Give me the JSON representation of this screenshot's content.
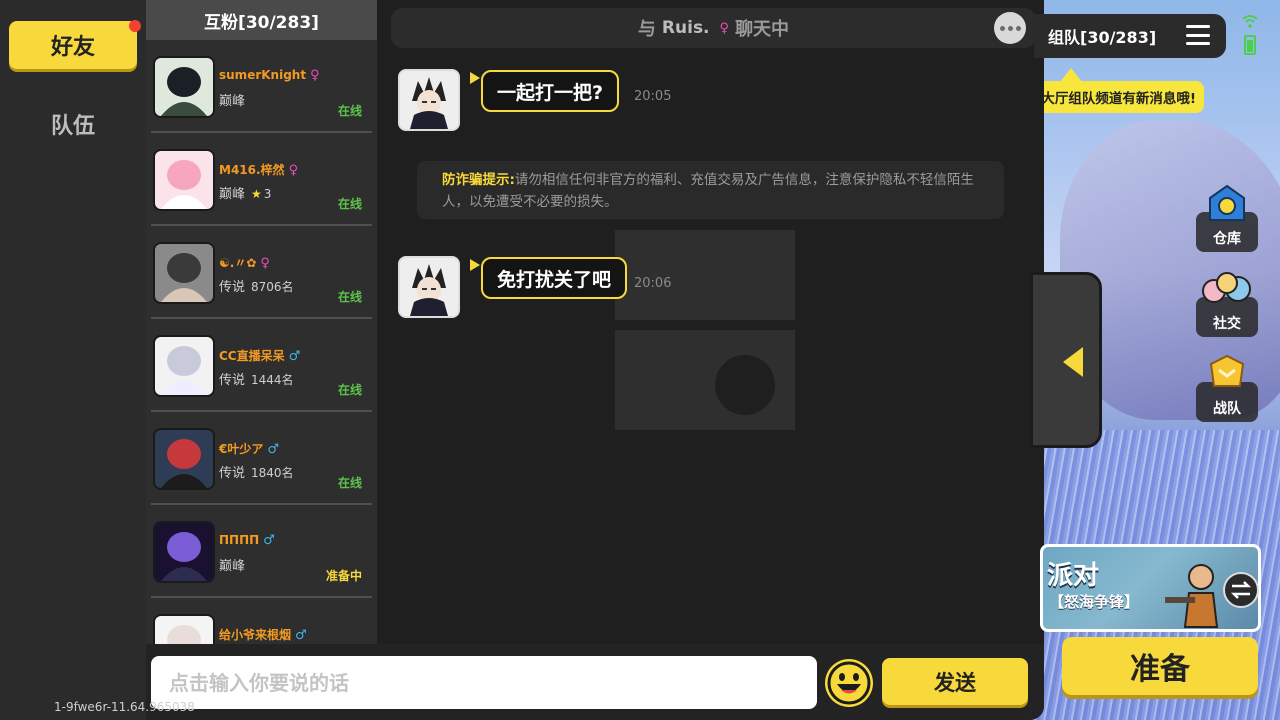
{
  "tabs": {
    "friends_label": "好友",
    "team_label": "队伍"
  },
  "friends_panel": {
    "header": "互粉[30/283]",
    "friends": [
      {
        "name": "sumerKnight",
        "gender": "♀",
        "rank": "巅峰",
        "rank_num": "",
        "stars": "",
        "status": "在线",
        "status_type": "online"
      },
      {
        "name": "M416.梓然",
        "gender": "♀",
        "rank": "巅峰",
        "rank_num": "3",
        "stars": "★",
        "status": "在线",
        "status_type": "online"
      },
      {
        "name": "☯.〃✿",
        "gender": "♀",
        "rank": "传说",
        "rank_num": "8706名",
        "stars": "",
        "status": "在线",
        "status_type": "online"
      },
      {
        "name": "CC直播呆呆",
        "gender": "♂",
        "rank": "传说",
        "rank_num": "1444名",
        "stars": "",
        "status": "在线",
        "status_type": "online"
      },
      {
        "name": "€叶少ア",
        "gender": "♂",
        "rank": "传说",
        "rank_num": "1840名",
        "stars": "",
        "status": "在线",
        "status_type": "online"
      },
      {
        "name": "ΠΠΠΠ",
        "gender": "♂",
        "rank": "巅峰",
        "rank_num": "",
        "stars": "",
        "status": "准备中",
        "status_type": "ready"
      },
      {
        "name": "给小爷来根烟",
        "gender": "♂",
        "rank": "",
        "rank_num": "",
        "stars": "",
        "status": "",
        "status_type": "online"
      }
    ]
  },
  "chat": {
    "title_prefix": "与",
    "partner_name": "Ruis.",
    "partner_gender": "♀",
    "title_suffix": "聊天中",
    "messages": [
      {
        "text": "一起打一把?",
        "time": "20:05"
      },
      {
        "text": "免打扰关了吧",
        "time": "20:06"
      }
    ],
    "tip_label": "防诈骗提示:",
    "tip_text": "请勿相信任何非官方的福利、充值交易及广告信息，注意保护隐私不轻信陌生人，以免遭受不必要的损失。"
  },
  "input": {
    "placeholder": "点击输入你要说的话",
    "send_label": "发送"
  },
  "hud": {
    "team_header": "组队[30/283]",
    "notice": "大厅组队频道有新消息哦!",
    "side_buttons": [
      "仓库",
      "社交",
      "战队"
    ],
    "mode_title": "派对",
    "mode_subtitle": "【怒海争锋】",
    "ready_label": "准备",
    "version": "1-9fwe6r-11.64.965038"
  },
  "colors": {
    "accent": "#f7d93c",
    "online": "#5cc24a",
    "female": "#e64fb3",
    "male": "#3fb6e6"
  }
}
